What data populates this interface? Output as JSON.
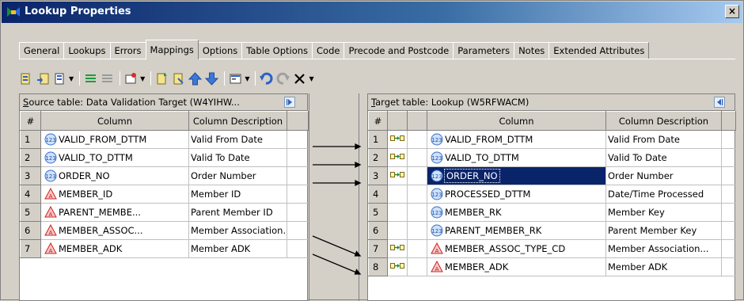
{
  "window": {
    "title": "Lookup Properties",
    "close_label": "×"
  },
  "tabs": [
    {
      "label": "General"
    },
    {
      "label": "Lookups"
    },
    {
      "label": "Errors"
    },
    {
      "label": "Mappings",
      "active": true
    },
    {
      "label": "Options"
    },
    {
      "label": "Table Options"
    },
    {
      "label": "Code"
    },
    {
      "label": "Precode and Postcode"
    },
    {
      "label": "Parameters"
    },
    {
      "label": "Notes"
    },
    {
      "label": "Extended Attributes"
    }
  ],
  "source": {
    "header_label": "Source table: Data Validation Target (W4YIHW...",
    "header_underline": "S",
    "header_rest": "ource table: Data Validation Target (W4YIHW...",
    "col_num": "#",
    "col_column": "Column",
    "col_desc": "Column Description",
    "rows": [
      {
        "num": "1",
        "icon": "numeric-column-icon",
        "name": "VALID_FROM_DTTM",
        "desc": "Valid From Date"
      },
      {
        "num": "2",
        "icon": "numeric-column-icon",
        "name": "VALID_TO_DTTM",
        "desc": "Valid To Date"
      },
      {
        "num": "3",
        "icon": "numeric-column-icon",
        "name": "ORDER_NO",
        "desc": "Order Number"
      },
      {
        "num": "4",
        "icon": "character-column-icon",
        "name": "MEMBER_ID",
        "desc": "Member ID"
      },
      {
        "num": "5",
        "icon": "character-column-icon",
        "name": "PARENT_MEMBE...",
        "desc": "Parent Member ID"
      },
      {
        "num": "6",
        "icon": "character-column-icon",
        "name": "MEMBER_ASSOC...",
        "desc": "Member Association..."
      },
      {
        "num": "7",
        "icon": "character-column-icon",
        "name": "MEMBER_ADK",
        "desc": "Member ADK"
      }
    ]
  },
  "target": {
    "header_underline": "T",
    "header_rest": "arget table: Lookup (W5RFWACM)",
    "col_num": "#",
    "col_column": "Column",
    "col_desc": "Column Description",
    "rows": [
      {
        "num": "1",
        "mapped": true,
        "icon": "numeric-column-icon",
        "name": "VALID_FROM_DTTM",
        "desc": "Valid From Date"
      },
      {
        "num": "2",
        "mapped": true,
        "icon": "numeric-column-icon",
        "name": "VALID_TO_DTTM",
        "desc": "Valid To Date"
      },
      {
        "num": "3",
        "mapped": true,
        "icon": "numeric-column-icon",
        "name": "ORDER_NO",
        "desc": "Order Number",
        "selected": true
      },
      {
        "num": "4",
        "mapped": false,
        "icon": "numeric-column-icon",
        "name": "PROCESSED_DTTM",
        "desc": "Date/Time Processed"
      },
      {
        "num": "5",
        "mapped": false,
        "icon": "numeric-column-icon",
        "name": "MEMBER_RK",
        "desc": "Member Key"
      },
      {
        "num": "6",
        "mapped": false,
        "icon": "numeric-column-icon",
        "name": "PARENT_MEMBER_RK",
        "desc": "Parent Member Key"
      },
      {
        "num": "7",
        "mapped": true,
        "icon": "character-column-icon",
        "name": "MEMBER_ASSOC_TYPE_CD",
        "desc": "Member Association..."
      },
      {
        "num": "8",
        "mapped": true,
        "icon": "character-column-icon",
        "name": "MEMBER_ADK",
        "desc": "Member ADK"
      }
    ]
  },
  "colors": {
    "title_start": "#0a246a",
    "title_end": "#a6caf0",
    "selection": "#0a246a"
  }
}
